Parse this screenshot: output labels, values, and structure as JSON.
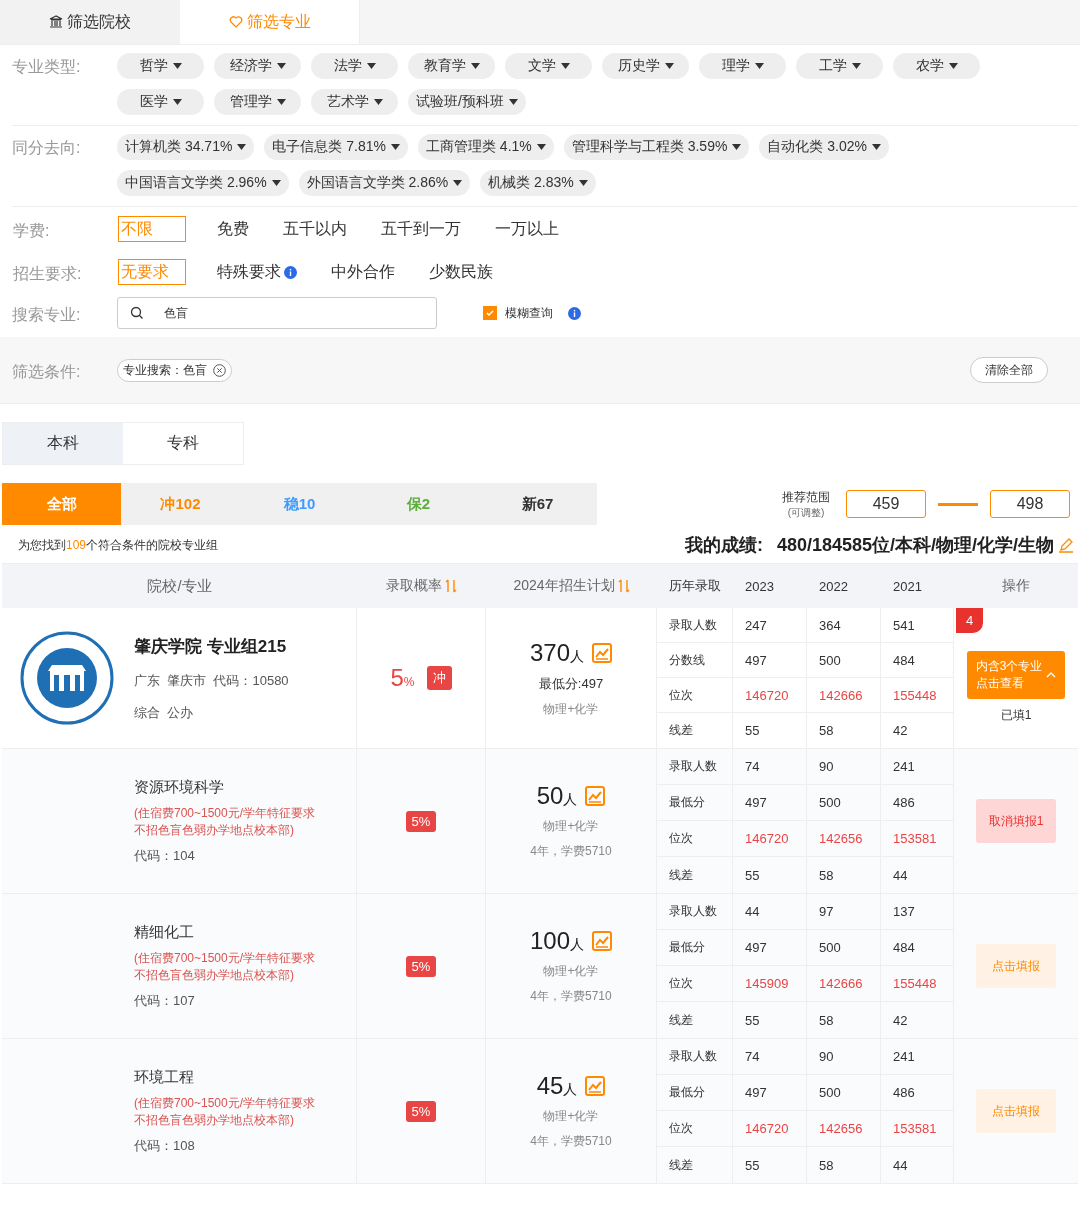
{
  "top_tabs": [
    {
      "label": "筛选院校",
      "selected": false
    },
    {
      "label": "筛选专业",
      "selected": true
    }
  ],
  "filters": {
    "major_type": {
      "label": "专业类型:",
      "chips": [
        "哲学",
        "经济学",
        "法学",
        "教育学",
        "文学",
        "历史学",
        "理学",
        "工学",
        "农学",
        "医学",
        "管理学",
        "艺术学",
        "试验班/预科班"
      ]
    },
    "same_score": {
      "label": "同分去向:",
      "chips": [
        "计算机类 34.71%",
        "电子信息类 7.81%",
        "工商管理类 4.1%",
        "管理科学与工程类 3.59%",
        "自动化类 3.02%",
        "中国语言文学类 2.96%",
        "外国语言文学类 2.86%",
        "机械类 2.83%"
      ]
    },
    "tuition": {
      "label": "学费:",
      "options": [
        {
          "label": "不限",
          "selected": true,
          "info": false
        },
        {
          "label": "免费",
          "selected": false,
          "info": false
        },
        {
          "label": "五千以内",
          "selected": false,
          "info": false
        },
        {
          "label": "五千到一万",
          "selected": false,
          "info": false
        },
        {
          "label": "一万以上",
          "selected": false,
          "info": false
        }
      ]
    },
    "requirement": {
      "label": "招生要求:",
      "options": [
        {
          "label": "无要求",
          "selected": true,
          "info": false
        },
        {
          "label": "特殊要求",
          "selected": false,
          "info": true
        },
        {
          "label": "中外合作",
          "selected": false,
          "info": false
        },
        {
          "label": "少数民族",
          "selected": false,
          "info": false
        }
      ]
    },
    "search": {
      "label": "搜索专业:",
      "value": "色盲",
      "fuzzy_label": "模糊查询",
      "fuzzy_checked": true
    },
    "conditions": {
      "label": "筛选条件:",
      "tags": [
        "专业搜索：色盲"
      ],
      "clear_button": "清除全部"
    }
  },
  "level_tabs": [
    {
      "label": "本科",
      "selected": true
    },
    {
      "label": "专科",
      "selected": false
    }
  ],
  "category_tabs": [
    {
      "label": "全部",
      "selected": true,
      "color": "#ff8a00"
    },
    {
      "label": "冲102",
      "selected": false,
      "color": "#ff8a00"
    },
    {
      "label": "稳10",
      "selected": false,
      "color": "#3d9bff"
    },
    {
      "label": "保2",
      "selected": false,
      "color": "#5aae3a"
    },
    {
      "label": "新67",
      "selected": false,
      "color": "#333333"
    }
  ],
  "range": {
    "label": "推荐范围",
    "sublabel": "(可调整)",
    "min": "459",
    "max": "498"
  },
  "found": {
    "prefix": "为您找到",
    "count": "109",
    "suffix": "个符合条件的院校专业组"
  },
  "score": {
    "label": "我的成绩:",
    "value": "480/184585位/本科/物理/化学/生物"
  },
  "table": {
    "columns": [
      "院校/专业",
      "录取概率",
      "2024年招生计划",
      "历年录取",
      "2023",
      "2022",
      "2021",
      "操作"
    ],
    "group": {
      "name": "肇庆学院 专业组215",
      "location": "广东  肇庆市  代码：10580",
      "tags": "综合  公办",
      "probability": "5",
      "probability_unit": "%",
      "risk": "冲",
      "plan": "370",
      "plan_unit": "人",
      "min_score": "最低分:497",
      "subjects": "物理+化学",
      "stats": [
        {
          "label": "录取人数",
          "values": [
            "247",
            "364",
            "541"
          ],
          "highlight": false
        },
        {
          "label": "分数线",
          "values": [
            "497",
            "500",
            "484"
          ],
          "highlight": false
        },
        {
          "label": "位次",
          "values": [
            "146720",
            "142666",
            "155448"
          ],
          "highlight": true
        },
        {
          "label": "线差",
          "values": [
            "55",
            "58",
            "42"
          ],
          "highlight": false
        }
      ],
      "count_badge": "4",
      "view_button": [
        "内含3个专业",
        "点击查看"
      ],
      "filled": "已填1"
    },
    "majors": [
      {
        "name": "资源环境科学",
        "note_lines": [
          "(住宿费700~1500元/学年特征要求",
          "不招色盲色弱办学地点校本部)"
        ],
        "code": "代码：104",
        "probability": "5%",
        "plan": "50",
        "plan_unit": "人",
        "subjects": "物理+化学",
        "fee": "4年，学费5710",
        "stats": [
          {
            "label": "录取人数",
            "values": [
              "74",
              "90",
              "241"
            ],
            "highlight": false
          },
          {
            "label": "最低分",
            "values": [
              "497",
              "500",
              "486"
            ],
            "highlight": false
          },
          {
            "label": "位次",
            "values": [
              "146720",
              "142656",
              "153581"
            ],
            "highlight": true
          },
          {
            "label": "线差",
            "values": [
              "55",
              "58",
              "44"
            ],
            "highlight": false
          }
        ],
        "action": {
          "kind": "cancel",
          "label": "取消填报1"
        }
      },
      {
        "name": "精细化工",
        "note_lines": [
          "(住宿费700~1500元/学年特征要求",
          "不招色盲色弱办学地点校本部)"
        ],
        "code": "代码：107",
        "probability": "5%",
        "plan": "100",
        "plan_unit": "人",
        "subjects": "物理+化学",
        "fee": "4年，学费5710",
        "stats": [
          {
            "label": "录取人数",
            "values": [
              "44",
              "97",
              "137"
            ],
            "highlight": false
          },
          {
            "label": "最低分",
            "values": [
              "497",
              "500",
              "484"
            ],
            "highlight": false
          },
          {
            "label": "位次",
            "values": [
              "145909",
              "142666",
              "155448"
            ],
            "highlight": true
          },
          {
            "label": "线差",
            "values": [
              "55",
              "58",
              "42"
            ],
            "highlight": false
          }
        ],
        "action": {
          "kind": "apply",
          "label": "点击填报"
        }
      },
      {
        "name": "环境工程",
        "note_lines": [
          "(住宿费700~1500元/学年特征要求",
          "不招色盲色弱办学地点校本部)"
        ],
        "code": "代码：108",
        "probability": "5%",
        "plan": "45",
        "plan_unit": "人",
        "subjects": "物理+化学",
        "fee": "4年，学费5710",
        "stats": [
          {
            "label": "录取人数",
            "values": [
              "74",
              "90",
              "241"
            ],
            "highlight": false
          },
          {
            "label": "最低分",
            "values": [
              "497",
              "500",
              "486"
            ],
            "highlight": false
          },
          {
            "label": "位次",
            "values": [
              "146720",
              "142656",
              "153581"
            ],
            "highlight": true
          },
          {
            "label": "线差",
            "values": [
              "55",
              "58",
              "44"
            ],
            "highlight": false
          }
        ],
        "action": {
          "kind": "apply",
          "label": "点击填报"
        }
      }
    ]
  }
}
